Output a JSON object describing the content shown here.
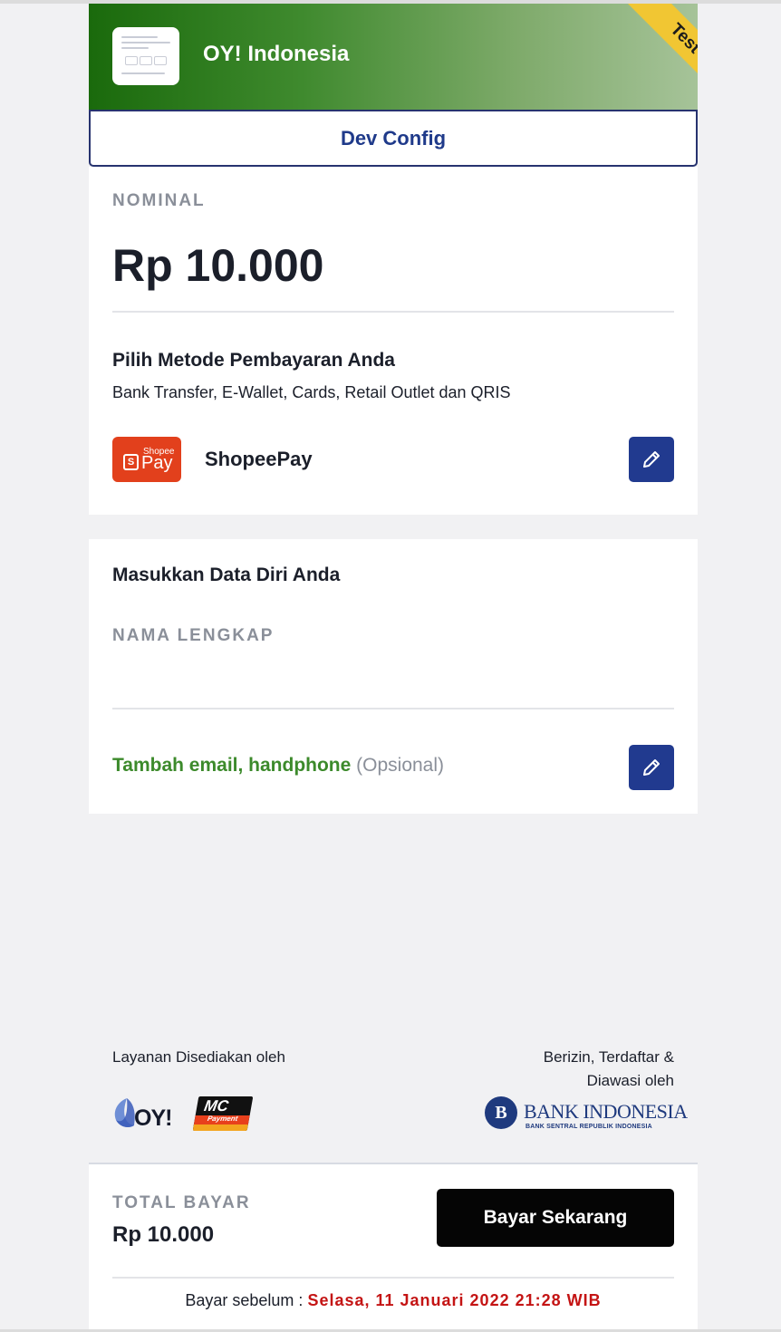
{
  "header": {
    "merchant_name": "OY! Indonesia",
    "ribbon": "Test",
    "dev_config_label": "Dev Config"
  },
  "payment": {
    "nominal_label": "NOMINAL",
    "amount": "Rp 10.000",
    "method_title": "Pilih Metode Pembayaran Anda",
    "method_subtitle": "Bank Transfer, E-Wallet, Cards, Retail Outlet dan QRIS",
    "selected_method": "ShopeePay",
    "selected_method_logo": {
      "small": "Shopee",
      "big": "Pay",
      "glyph": "S"
    }
  },
  "personal": {
    "title": "Masukkan Data Diri Anda",
    "name_label": "NAMA LENGKAP",
    "name_value": "",
    "optional_link": "Tambah email, handphone",
    "optional_note": "(Opsional)"
  },
  "footer": {
    "provided_by": "Layanan Disediakan oleh",
    "licensed_by": "Berizin, Terdaftar & Diawasi oleh",
    "oy_logo_text": "OY!",
    "mc_logo": {
      "top": "MC",
      "bottom": "Payment"
    },
    "bank_name": "BANK INDONESIA",
    "bank_subtitle": "BANK SENTRAL REPUBLIK INDONESIA"
  },
  "summary": {
    "total_label": "TOTAL BAYAR",
    "total_amount": "Rp 10.000",
    "pay_button": "Bayar Sekarang",
    "deadline_label": "Bayar sebelum :",
    "deadline_value": "Selasa, 11 Januari 2022 21:28 WIB"
  },
  "colors": {
    "primary": "#213a8f",
    "header_gradient_start": "#1a6a0c",
    "ribbon": "#f1c633",
    "accent_green": "#3c8a2b",
    "deadline_red": "#c41414"
  },
  "icons": {
    "edit": "pencil-icon",
    "bank_seal": "bank-indonesia-seal"
  }
}
